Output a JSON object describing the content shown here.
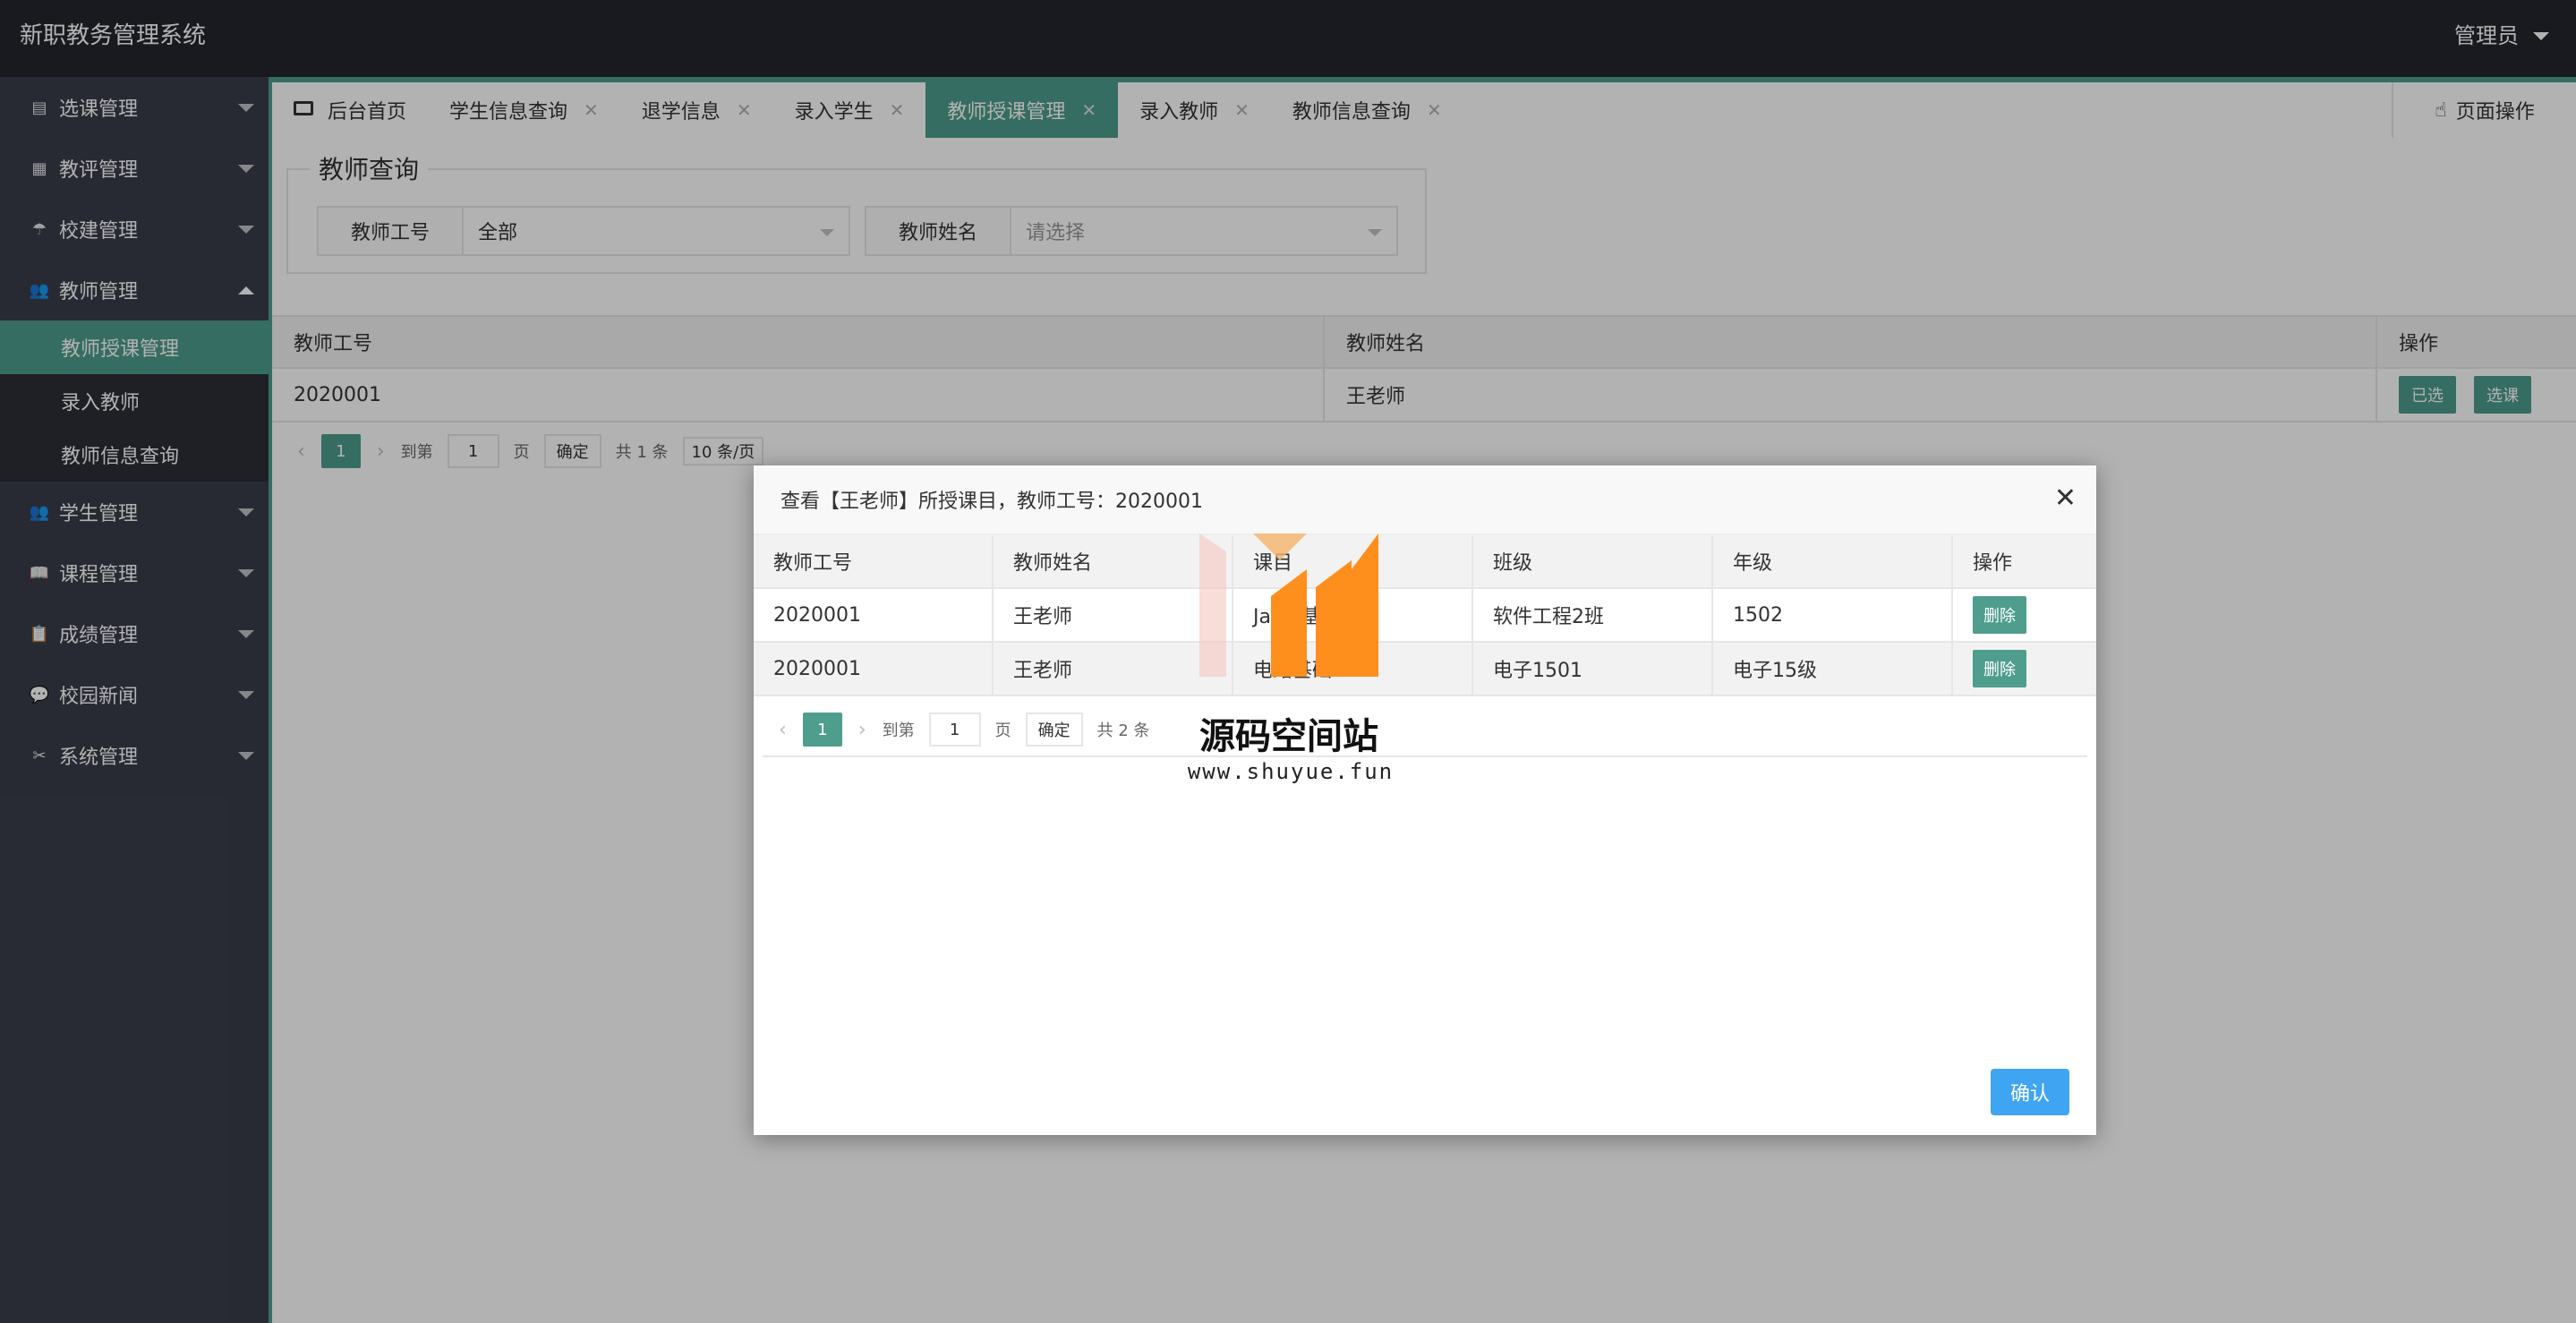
{
  "header": {
    "app_title": "新职教务管理系统",
    "user_label": "管理员"
  },
  "sidebar": {
    "items": [
      {
        "label": "选课管理",
        "icon": "document-icon"
      },
      {
        "label": "教评管理",
        "icon": "grid-icon"
      },
      {
        "label": "校建管理",
        "icon": "umbrella-icon"
      },
      {
        "label": "教师管理",
        "icon": "users-icon",
        "expanded": true,
        "children": [
          "教师授课管理",
          "录入教师",
          "教师信息查询"
        ]
      },
      {
        "label": "学生管理",
        "icon": "users-icon"
      },
      {
        "label": "课程管理",
        "icon": "book-icon"
      },
      {
        "label": "成绩管理",
        "icon": "clipboard-icon"
      },
      {
        "label": "校园新闻",
        "icon": "chat-icon"
      },
      {
        "label": "系统管理",
        "icon": "tools-icon"
      }
    ],
    "active_child": "教师授课管理"
  },
  "tabs": [
    {
      "label": "后台首页",
      "closable": false
    },
    {
      "label": "学生信息查询",
      "closable": true
    },
    {
      "label": "退学信息",
      "closable": true
    },
    {
      "label": "录入学生",
      "closable": true
    },
    {
      "label": "教师授课管理",
      "closable": true,
      "active": true
    },
    {
      "label": "录入教师",
      "closable": true
    },
    {
      "label": "教师信息查询",
      "closable": true
    }
  ],
  "page_ops_label": "页面操作",
  "query": {
    "legend": "教师查询",
    "field1": {
      "label": "教师工号",
      "value": "全部"
    },
    "field2": {
      "label": "教师姓名",
      "placeholder": "请选择"
    }
  },
  "main_table": {
    "headers": [
      "教师工号",
      "教师姓名",
      "操作"
    ],
    "rows": [
      {
        "id": "2020001",
        "name": "王老师",
        "actions": [
          "已选",
          "选课"
        ]
      }
    ]
  },
  "main_pager": {
    "current": "1",
    "goto_label": "到第",
    "page_input": "1",
    "page_unit": "页",
    "ok": "确定",
    "total": "共 1 条",
    "page_size": "10 条/页"
  },
  "modal": {
    "title": "查看【王老师】所授课目，教师工号：2020001",
    "headers": [
      "教师工号",
      "教师姓名",
      "课目",
      "班级",
      "年级",
      "操作"
    ],
    "rows": [
      [
        "2020001",
        "王老师",
        "Java 基础",
        "软件工程2班",
        "1502",
        "删除"
      ],
      [
        "2020001",
        "王老师",
        "电路基础",
        "电子1501",
        "电子15级",
        "删除"
      ]
    ],
    "pager": {
      "current": "1",
      "goto_label": "到第",
      "page_input": "1",
      "page_unit": "页",
      "ok": "确定",
      "total": "共 2 条"
    },
    "confirm_label": "确认"
  },
  "watermark": {
    "text": "源码空间站",
    "url": "www.shuyue.fun"
  },
  "colors": {
    "accent": "#4e9d8d",
    "header_bg": "#23262e",
    "sidebar_bg": "#393d49",
    "confirm_blue": "#3fa4f2"
  }
}
